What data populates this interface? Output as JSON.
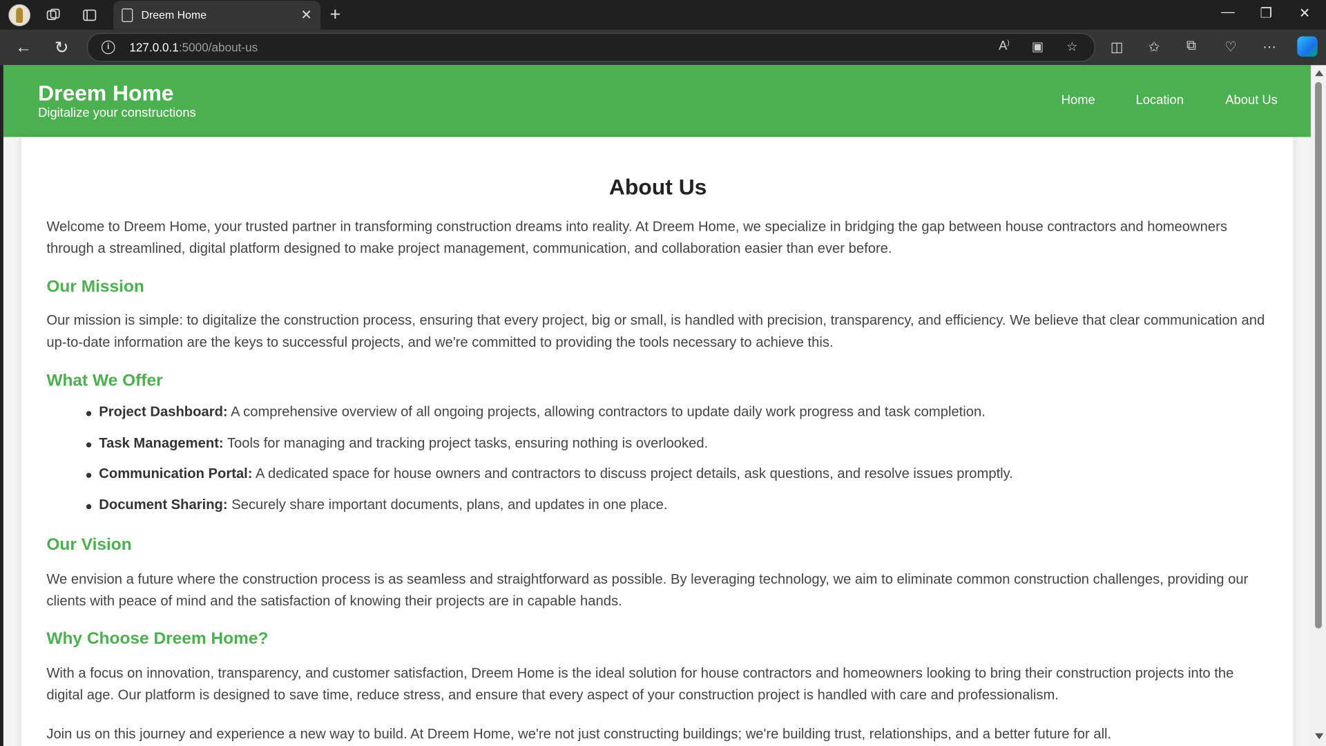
{
  "browser": {
    "tab_title": "Dreem Home",
    "url_host": "127.0.0.1",
    "url_path": ":5000/about-us"
  },
  "site": {
    "brand_title": "Dreem Home",
    "brand_tagline": "Digitalize your constructions",
    "nav": [
      "Home",
      "Location",
      "About Us"
    ],
    "accent_color": "#4caf50"
  },
  "content": {
    "heading": "About Us",
    "intro": "Welcome to Dreem Home, your trusted partner in transforming construction dreams into reality. At Dreem Home, we specialize in bridging the gap between house contractors and homeowners through a streamlined, digital platform designed to make project management, communication, and collaboration easier than ever before.",
    "mission_heading": "Our Mission",
    "mission_text": "Our mission is simple: to digitalize the construction process, ensuring that every project, big or small, is handled with precision, transparency, and efficiency. We believe that clear communication and up-to-date information are the keys to successful projects, and we're committed to providing the tools necessary to achieve this.",
    "offer_heading": "What We Offer",
    "offers": [
      {
        "title": "Project Dashboard:",
        "text": " A comprehensive overview of all ongoing projects, allowing contractors to update daily work progress and task completion."
      },
      {
        "title": "Task Management:",
        "text": " Tools for managing and tracking project tasks, ensuring nothing is overlooked."
      },
      {
        "title": "Communication Portal:",
        "text": " A dedicated space for house owners and contractors to discuss project details, ask questions, and resolve issues promptly."
      },
      {
        "title": "Document Sharing:",
        "text": " Securely share important documents, plans, and updates in one place."
      }
    ],
    "vision_heading": "Our Vision",
    "vision_text": "We envision a future where the construction process is as seamless and straightforward as possible. By leveraging technology, we aim to eliminate common construction challenges, providing our clients with peace of mind and the satisfaction of knowing their projects are in capable hands.",
    "why_heading": "Why Choose Dreem Home?",
    "why_text": "With a focus on innovation, transparency, and customer satisfaction, Dreem Home is the ideal solution for house contractors and homeowners looking to bring their construction projects into the digital age. Our platform is designed to save time, reduce stress, and ensure that every aspect of your construction project is handled with care and professionalism.",
    "closing": "Join us on this journey and experience a new way to build. At Dreem Home, we're not just constructing buildings; we're building trust, relationships, and a better future for all."
  }
}
